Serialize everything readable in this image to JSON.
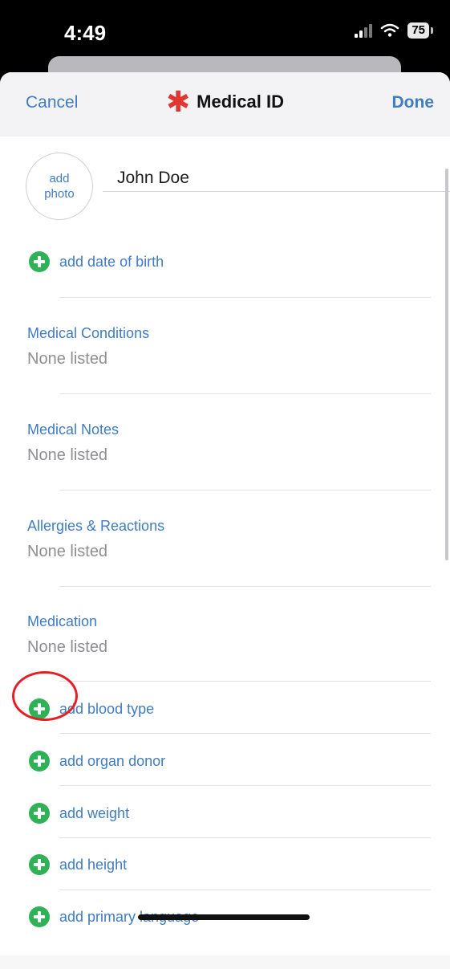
{
  "status_bar": {
    "time": "4:49",
    "battery": "75"
  },
  "nav": {
    "cancel": "Cancel",
    "title": "Medical ID",
    "done": "Done",
    "title_icon": "asterisk-icon"
  },
  "profile": {
    "photo_label": "add photo",
    "name": "John Doe"
  },
  "add_dob": "add date of birth",
  "sections": [
    {
      "title": "Medical Conditions",
      "value": "None listed"
    },
    {
      "title": "Medical Notes",
      "value": "None listed"
    },
    {
      "title": "Allergies & Reactions",
      "value": "None listed"
    },
    {
      "title": "Medication",
      "value": "None listed"
    }
  ],
  "add_items": [
    {
      "label": "add blood type"
    },
    {
      "label": "add organ donor"
    },
    {
      "label": "add weight"
    },
    {
      "label": "add height"
    },
    {
      "label": "add primary language"
    }
  ],
  "colors": {
    "accent": "#3f7cc2",
    "plus_green": "#2fb157",
    "star_red": "#e0382e",
    "annotation_red": "#e61e25"
  }
}
